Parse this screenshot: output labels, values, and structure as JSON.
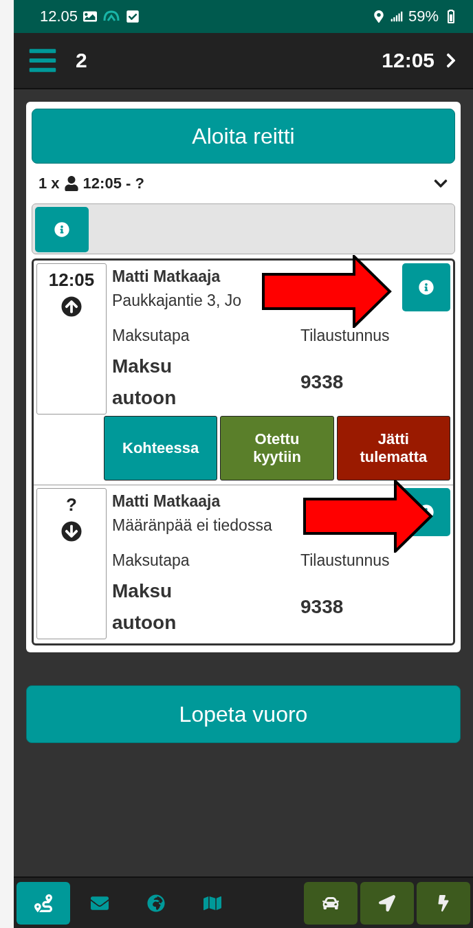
{
  "status_bar": {
    "time": "12.05",
    "battery": "59%"
  },
  "header": {
    "count": "2",
    "time": "12:05"
  },
  "start_button": "Aloita reitti",
  "summary": {
    "count": "1 x",
    "time": "12:05 - ?",
    "expanded": false
  },
  "stops": [
    {
      "time": "12:05",
      "kind": "pickup",
      "name": "Matti Matkaaja",
      "address": "Paukkajantie 3, Jo",
      "payment_label": "Maksutapa",
      "payment": "Maksu autoon",
      "order_label": "Tilaustunnus",
      "order": "9338",
      "highlighted": true,
      "actions": [
        {
          "label": "Kohteessa",
          "color": "#009999"
        },
        {
          "label": "Otettu kyytiin",
          "color": "#5a7f2a"
        },
        {
          "label": "Jätti tulematta",
          "color": "#9a1a00"
        }
      ]
    },
    {
      "time": "?",
      "kind": "dropoff",
      "name": "Matti Matkaaja",
      "address": "Määränpää ei tiedossa",
      "payment_label": "Maksutapa",
      "payment": "Maksu autoon",
      "order_label": "Tilaustunnus",
      "order": "9338",
      "highlighted": true
    }
  ],
  "end_button": "Lopeta vuoro",
  "bottom_nav": [
    {
      "kind": "route",
      "selected": true
    },
    {
      "kind": "mail",
      "selected": false
    },
    {
      "kind": "globe",
      "selected": false
    },
    {
      "kind": "map",
      "selected": false
    }
  ],
  "quick_actions": [
    {
      "kind": "car"
    },
    {
      "kind": "navigate"
    },
    {
      "kind": "bolt"
    }
  ]
}
